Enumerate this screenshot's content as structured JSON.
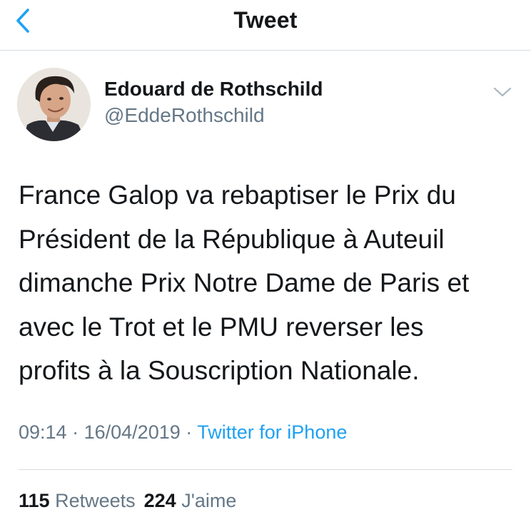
{
  "nav": {
    "title": "Tweet",
    "back_icon": "chevron-left-icon"
  },
  "author": {
    "display_name": "Edouard de Rothschild",
    "handle": "@EddeRothschild",
    "menu_icon": "chevron-down-icon"
  },
  "tweet": {
    "lines": [
      "France Galop va rebaptiser le Prix du",
      "Président de la République à Auteuil",
      "dimanche Prix Notre Dame de Paris et",
      "avec le Trot et le PMU reverser les",
      "profits à la Souscription Nationale."
    ],
    "time": "09:14",
    "separator": "·",
    "date": "16/04/2019",
    "source": "Twitter for iPhone"
  },
  "stats": {
    "retweets_count": "115",
    "retweets_label": "Retweets",
    "likes_count": "224",
    "likes_label": "J'aime"
  },
  "colors": {
    "accent": "#1da1f2",
    "text": "#14171a",
    "secondary": "#657786",
    "divider": "#d8dde1"
  }
}
